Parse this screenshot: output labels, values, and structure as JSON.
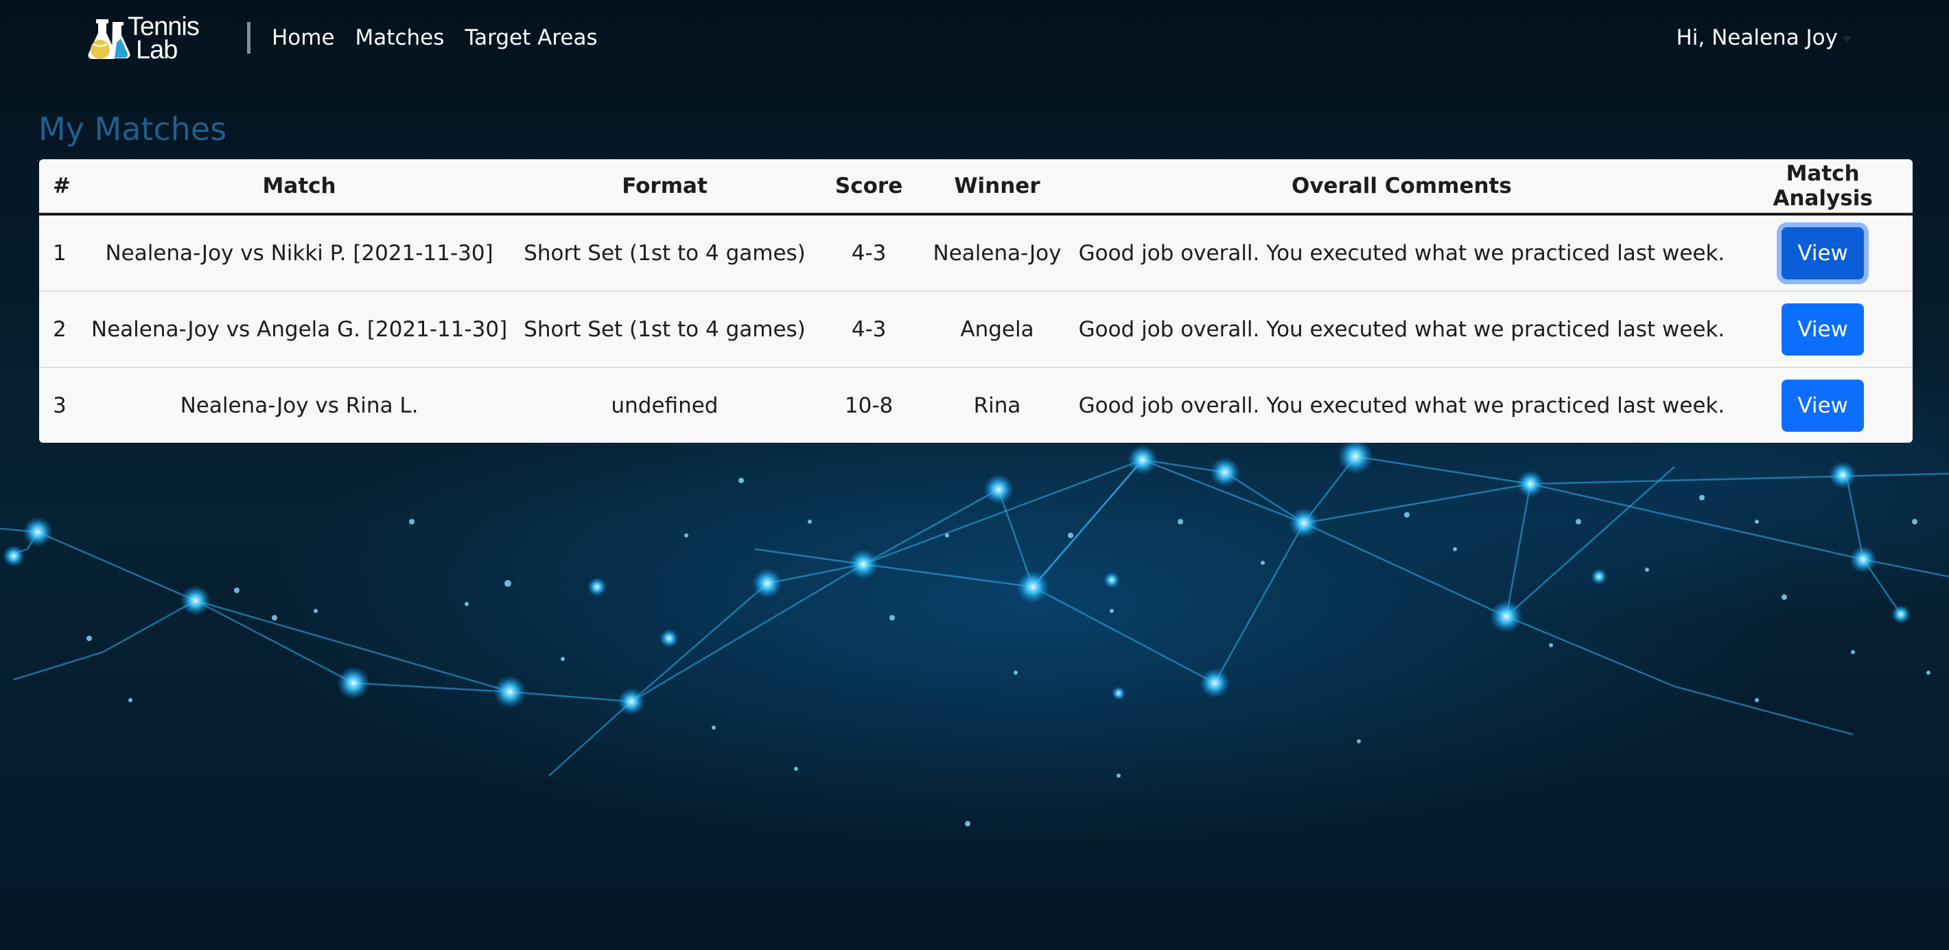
{
  "colors": {
    "background": "#041624",
    "page_title": "#1f5f8d",
    "primary_button": "#0d6efd",
    "table_background": "#f8f8f8"
  },
  "navbar": {
    "logo_text_line1": "Tennis",
    "logo_text_line2": "Lab",
    "links": [
      {
        "label": "Home"
      },
      {
        "label": "Matches"
      },
      {
        "label": "Target Areas"
      }
    ],
    "user_greeting": "Hi, Nealena Joy"
  },
  "page": {
    "title": "My Matches"
  },
  "table": {
    "headers": [
      "#",
      "Match",
      "Format",
      "Score",
      "Winner",
      "Overall Comments",
      "Match Analysis"
    ],
    "rows": [
      {
        "num": "1",
        "match": "Nealena-Joy vs Nikki P. [2021-11-30]",
        "format": "Short Set (1st to 4 games)",
        "score": "4-3",
        "winner": "Nealena-Joy",
        "comments": "Good job overall. You executed what we practiced last week.",
        "action": "View",
        "focused": true
      },
      {
        "num": "2",
        "match": "Nealena-Joy vs Angela G. [2021-11-30]",
        "format": "Short Set (1st to 4 games)",
        "score": "4-3",
        "winner": "Angela",
        "comments": "Good job overall. You executed what we practiced last week.",
        "action": "View",
        "focused": false
      },
      {
        "num": "3",
        "match": "Nealena-Joy vs Rina L.",
        "format": "undefined",
        "score": "10-8",
        "winner": "Rina",
        "comments": "Good job overall. You executed what we practiced last week.",
        "action": "View",
        "focused": false
      }
    ]
  }
}
